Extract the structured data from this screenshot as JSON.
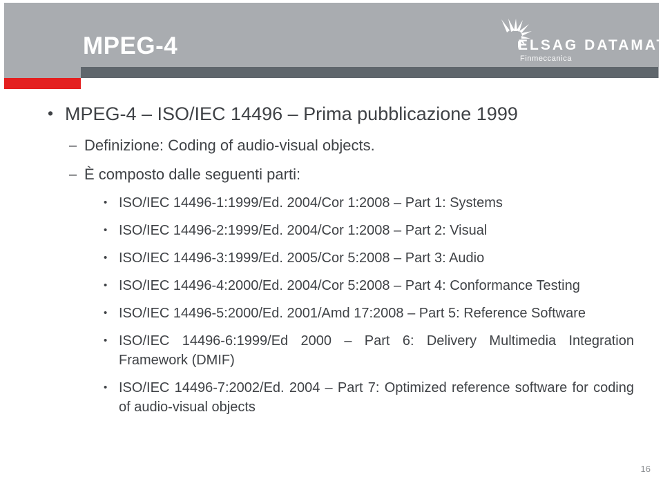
{
  "header": {
    "title": "MPEG-4",
    "logo": {
      "wordmark": "ELSAG DATAMAT",
      "subtitle": "Finmeccanica",
      "burst_icon": "radial-burst-icon"
    },
    "colors": {
      "band": "#a9acb0",
      "dark_bar": "#5f666c",
      "red_block": "#e41f1f",
      "title_text": "#ffffff"
    }
  },
  "content": {
    "text_color": "#3f4246",
    "bullet_level1": "•",
    "bullet_level2": "–",
    "bullet_level3": "•",
    "heading": "MPEG-4 – ISO/IEC 14496 – Prima pubblicazione 1999",
    "sub_items": [
      "Definizione: Coding of audio-visual objects.",
      "È composto dalle seguenti parti:"
    ],
    "parts": [
      "ISO/IEC 14496-1:1999/Ed. 2004/Cor 1:2008 – Part 1: Systems",
      "ISO/IEC 14496-2:1999/Ed. 2004/Cor 1:2008  – Part 2: Visual",
      "ISO/IEC 14496-3:1999/Ed. 2005/Cor 5:2008 – Part 3: Audio",
      "ISO/IEC 14496-4:2000/Ed. 2004/Cor 5:2008 – Part 4: Conformance Testing",
      "ISO/IEC 14496-5:2000/Ed. 2001/Amd 17:2008 – Part 5: Reference Software",
      "ISO/IEC 14496-6:1999/Ed 2000 – Part 6: Delivery Multimedia Integration Framework (DMIF)",
      "ISO/IEC 14496-7:2002/Ed. 2004 – Part 7: Optimized reference software for coding of audio-visual objects"
    ]
  },
  "footer": {
    "page_number": "16"
  }
}
